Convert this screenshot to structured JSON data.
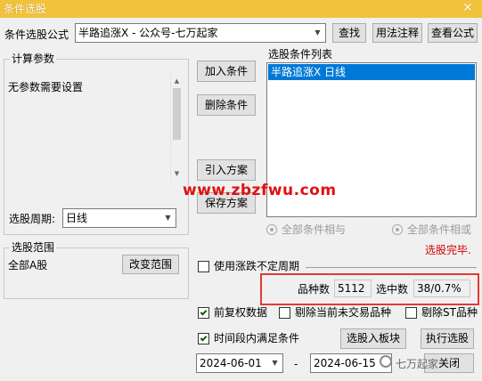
{
  "window": {
    "title": "条件选股",
    "close_glyph": "✕"
  },
  "formula_row": {
    "label": "条件选股公式",
    "value": "半路追涨X  -  公众号-七万起家",
    "find_button": "查找",
    "usage_button": "用法注释",
    "view_button": "查看公式"
  },
  "params": {
    "title": "计算参数",
    "text": "无参数需要设置",
    "period_label": "选股周期:",
    "period_value": "日线"
  },
  "actions": {
    "add": "加入条件",
    "delete": "删除条件",
    "import": "引入方案",
    "save": "保存方案"
  },
  "conditions": {
    "title": "选股条件列表",
    "items": [
      "半路追涨X  日线"
    ],
    "radio_and": "全部条件相与",
    "radio_or": "全部条件相或",
    "status": "选股完毕."
  },
  "range": {
    "title": "选股范围",
    "value": "全部A股",
    "change_button": "改变范围"
  },
  "options": {
    "use_period_label": "使用涨跌不定周期",
    "use_period_checked": false,
    "count_label": "品种数",
    "count_value": "5112",
    "selected_label": "选中数",
    "selected_value": "38/0.7%",
    "adj_label": "前复权数据",
    "adj_checked": true,
    "exclude_untraded_label": "剔除当前未交易品种",
    "exclude_untraded_checked": false,
    "exclude_st_label": "剔除ST品种",
    "exclude_st_checked": false,
    "time_label": "时间段内满足条件",
    "time_checked": true,
    "to_block_button": "选股入板块",
    "run_button": "执行选股",
    "close_button": "关闭",
    "date_from": "2024-06-01",
    "date_sep": "-",
    "date_to": "2024-06-15"
  },
  "overlay": {
    "site_watermark": "www.zbzfwu.com",
    "brand_watermark": "七万起家"
  }
}
